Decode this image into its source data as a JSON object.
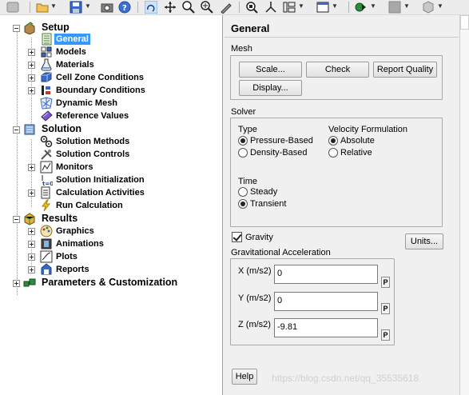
{
  "toolbar": {
    "icons": [
      "window-icon",
      "open-folder-icon",
      "save-icon",
      "camera-icon",
      "help-icon",
      "rotate-icon",
      "pan-icon",
      "zoom-icon",
      "zoom-in-icon",
      "probe-icon",
      "zoom-fit-icon",
      "axes-icon",
      "layout-icon",
      "window-layout-icon",
      "view-icon",
      "color-icon",
      "cube-icon"
    ]
  },
  "tree": {
    "setup": {
      "label": "Setup",
      "items": [
        "General",
        "Models",
        "Materials",
        "Cell Zone Conditions",
        "Boundary Conditions",
        "Dynamic Mesh",
        "Reference Values"
      ]
    },
    "solution": {
      "label": "Solution",
      "items": [
        "Solution Methods",
        "Solution Controls",
        "Monitors",
        "Solution Initialization",
        "Calculation Activities",
        "Run Calculation"
      ]
    },
    "results": {
      "label": "Results",
      "items": [
        "Graphics",
        "Animations",
        "Plots",
        "Reports"
      ]
    },
    "parameters": {
      "label": "Parameters & Customization"
    },
    "selected": "General"
  },
  "panel": {
    "title": "General",
    "mesh": {
      "label": "Mesh",
      "scale": "Scale...",
      "check": "Check",
      "report_quality": "Report Quality",
      "display": "Display..."
    },
    "solver": {
      "label": "Solver",
      "type_label": "Type",
      "type_options": [
        "Pressure-Based",
        "Density-Based"
      ],
      "type_selected": "Pressure-Based",
      "velocity_label": "Velocity Formulation",
      "velocity_options": [
        "Absolute",
        "Relative"
      ],
      "velocity_selected": "Absolute",
      "time_label": "Time",
      "time_options": [
        "Steady",
        "Transient"
      ],
      "time_selected": "Transient"
    },
    "gravity": {
      "label": "Gravity",
      "checked": true,
      "units": "Units..."
    },
    "acceleration": {
      "label": "Gravitational Acceleration",
      "x_label": "X (m/s2)",
      "x_value": "0",
      "y_label": "Y (m/s2)",
      "y_value": "0",
      "z_label": "Z (m/s2)",
      "z_value": "-9.81",
      "param_button": "P"
    },
    "help": "Help"
  },
  "watermark": "https://blog.csdn.net/qq_35535618"
}
